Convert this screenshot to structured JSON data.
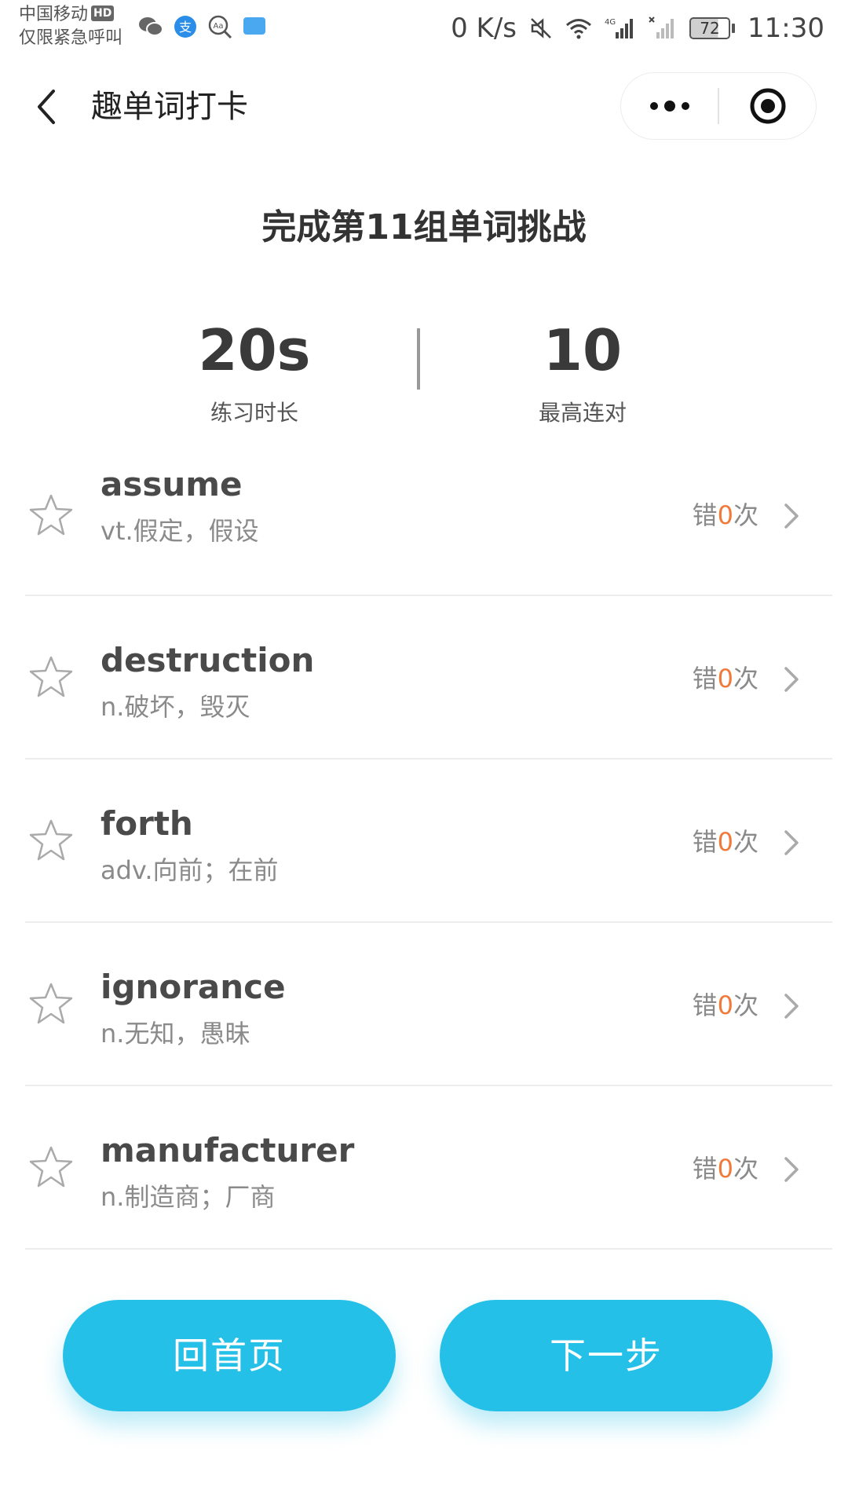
{
  "status_bar": {
    "carrier": "中国移动",
    "hd": "HD",
    "emergency": "仅限紧急呼叫",
    "speed": "0 K/s",
    "battery": "72",
    "time": "11:30"
  },
  "nav": {
    "title": "趣单词打卡"
  },
  "header": {
    "title": "完成第11组单词挑战"
  },
  "stats": {
    "duration_value": "20s",
    "duration_label": "练习时长",
    "streak_value": "10",
    "streak_label": "最高连对"
  },
  "mistake_prefix": "错",
  "mistake_suffix": "次",
  "words": [
    {
      "word": "assume",
      "meaning": "vt.假定，假设",
      "mistakes": "0"
    },
    {
      "word": "destruction",
      "meaning": "n.破坏，毁灭",
      "mistakes": "0"
    },
    {
      "word": "forth",
      "meaning": "adv.向前；在前",
      "mistakes": "0"
    },
    {
      "word": "ignorance",
      "meaning": "n.无知，愚昧",
      "mistakes": "0"
    },
    {
      "word": "manufacturer",
      "meaning": "n.制造商；厂商",
      "mistakes": "0"
    }
  ],
  "buttons": {
    "home": "回首页",
    "next": "下一步"
  },
  "colors": {
    "accent": "#25c0e8",
    "mistake_count": "#f07a3a"
  }
}
